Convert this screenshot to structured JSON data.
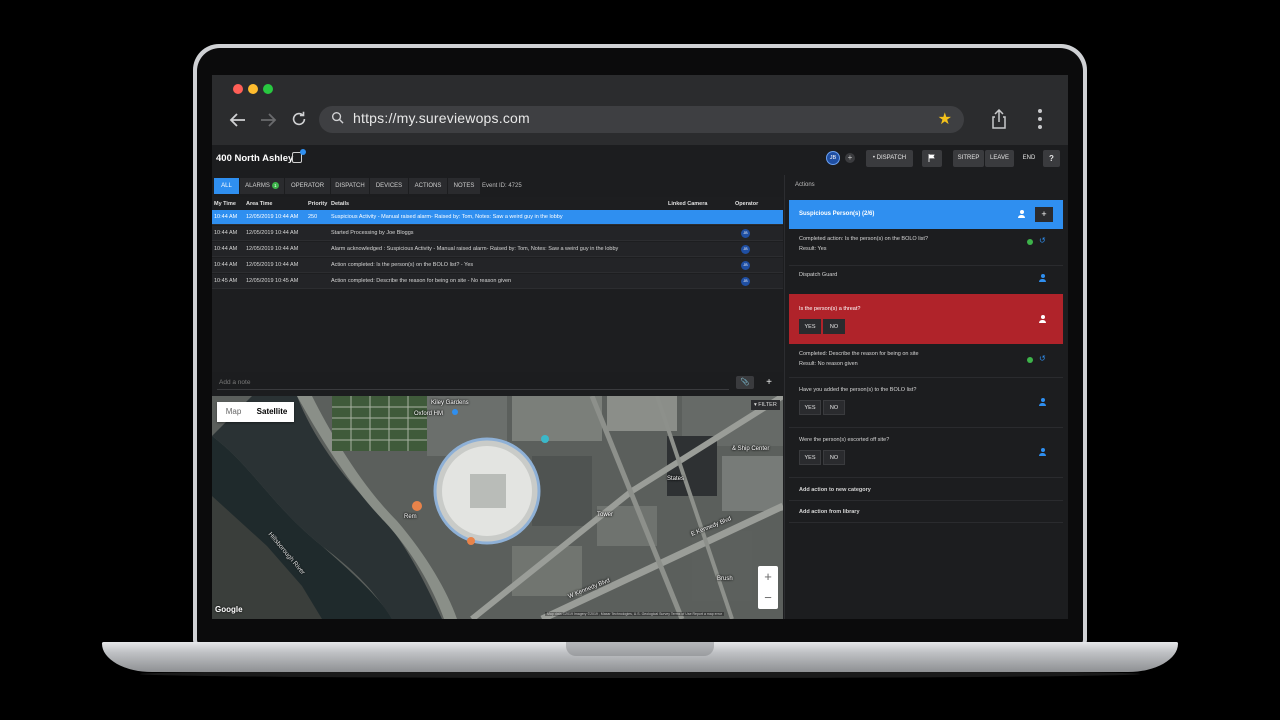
{
  "browser": {
    "url": "https://my.sureviewops.com",
    "colors": {
      "close": "#ff5f57",
      "minimize": "#febc2e",
      "maximize": "#28c840",
      "bookmark": "#f4c21b"
    },
    "icons": [
      "back-arrow-icon",
      "forward-arrow-icon",
      "reload-icon",
      "search-icon",
      "bookmark-star-icon",
      "share-icon",
      "more-menu-icon"
    ]
  },
  "header": {
    "site_title": "400 North Ashley",
    "user_initials": "JB",
    "add_user": "+",
    "dispatch_label": "• DISPATCH",
    "flag_icon": "flag-icon",
    "sitrep_label": "SITREP",
    "leave_label": "LEAVE",
    "end_label": "END",
    "help_label": "?"
  },
  "tabs": {
    "all": "ALL",
    "alarms": "ALARMS",
    "alarms_count": "1",
    "operator": "OPERATOR",
    "dispatch": "DISPATCH",
    "devices": "DEVICES",
    "actions": "ACTIONS",
    "notes": "NOTES",
    "event_id": "Event ID: 4725"
  },
  "table": {
    "columns": {
      "my_time": "My Time",
      "area_time": "Area Time",
      "priority": "Priority",
      "details": "Details",
      "linked_camera": "Linked Camera",
      "operator": "Operator"
    },
    "rows": [
      {
        "my_time": "10:44 AM",
        "area_time": "12/05/2019 10:44 AM",
        "priority": "250",
        "details": "Suspicious Activity - Manual raised alarm- Raised by: Tom, Notes: Saw a weird guy in the lobby",
        "operator": ""
      },
      {
        "my_time": "10:44 AM",
        "area_time": "12/05/2019 10:44 AM",
        "priority": "",
        "details": "Started Processing by Joe Bloggs",
        "operator": "JB"
      },
      {
        "my_time": "10:44 AM",
        "area_time": "12/05/2019 10:44 AM",
        "priority": "",
        "details": "Alarm acknowledged : Suspicious Activity - Manual raised alarm- Raised by: Tom, Notes: Saw a weird guy in the lobby",
        "operator": "JB"
      },
      {
        "my_time": "10:44 AM",
        "area_time": "12/05/2019 10:44 AM",
        "priority": "",
        "details": "Action completed: Is the person(s) on the BOLO list? - Yes",
        "operator": "JB"
      },
      {
        "my_time": "10:45 AM",
        "area_time": "12/05/2019 10:45 AM",
        "priority": "",
        "details": "Action completed: Describe the reason for being on site - No reason given",
        "operator": "JB"
      }
    ]
  },
  "note": {
    "placeholder": "Add a note",
    "add": "+"
  },
  "map": {
    "map_label": "Map",
    "satellite_label": "Satellite",
    "filter_label": "▾ FILTER",
    "zoom_in": "+",
    "zoom_out": "−",
    "google": "Google",
    "copyright": "Map data ©2019 Imagery ©2019 , Maxar Technologies, U.S. Geological Survey  Terms of Use  Report a map error",
    "labels": {
      "kiley_gardens": "Kiley Gardens",
      "oxford": "Oxford HM",
      "river": "Hillsborough River",
      "kennedy": "E Kennedy Blvd",
      "kennedy_w": "W Kennedy Blvd",
      "ship_center": "& Ship Center",
      "states": "States",
      "tower": "Tower",
      "rem": "Rem",
      "brush": "Brush"
    }
  },
  "actions": {
    "title": "Actions",
    "category": "Suspicious Person(s) (2/6)",
    "category_add": "+",
    "items": {
      "bolo_done": "Completed action: Is the person(s) on the BOLO list?",
      "bolo_result": "Result: Yes",
      "dispatch_guard": "Dispatch Guard",
      "threat_question": "Is the person(s) a threat?",
      "reason_done": "Completed: Describe the reason for being on site",
      "reason_result": "Result: No reason given",
      "added_bolo": "Have you added the person(s) to the BOLO list?",
      "escorted": "Were the person(s) escorted off site?"
    },
    "yes": "YES",
    "no": "NO",
    "add_new_category": "Add action to new category",
    "add_from_library": "Add action from library",
    "colors": {
      "category": "#2f8ff0",
      "threat": "#b0232a",
      "done": "#3db34a"
    }
  }
}
